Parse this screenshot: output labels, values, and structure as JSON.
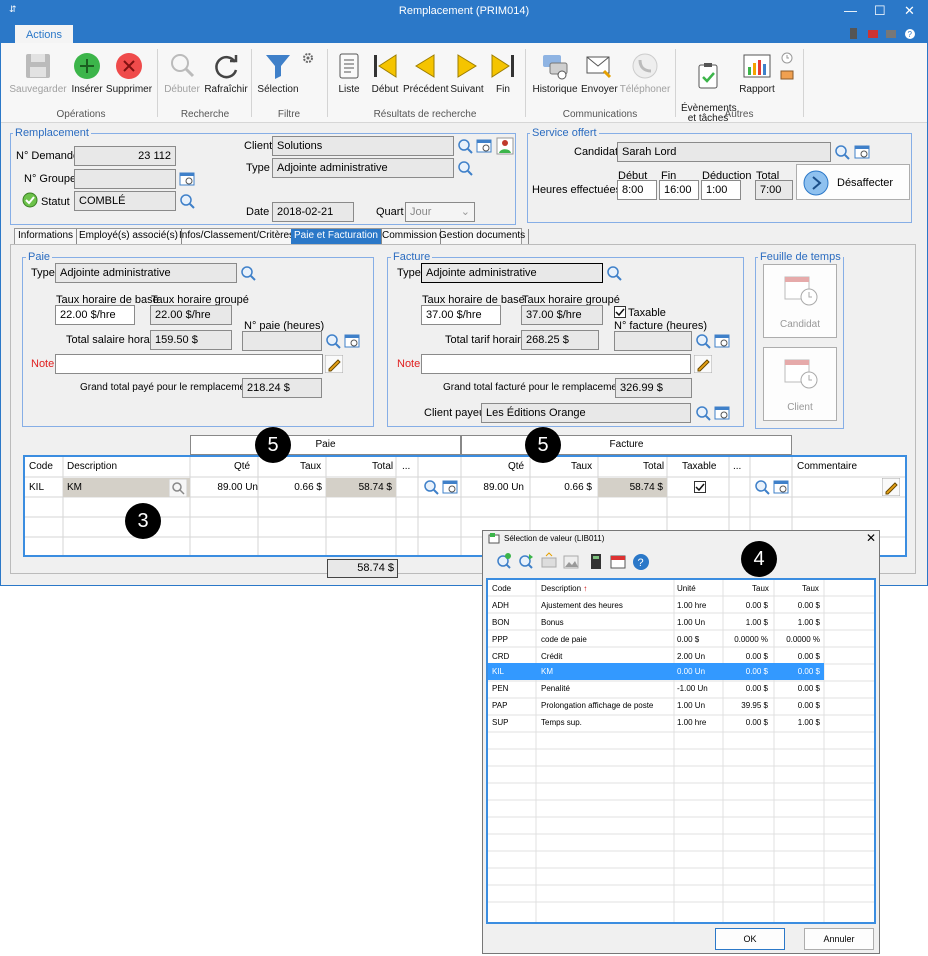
{
  "window": {
    "title": "Remplacement (PRIM014)"
  },
  "ribbon": {
    "tab": "Actions",
    "buttons": {
      "save": "Sauvegarder",
      "insert": "Insérer",
      "delete": "Supprimer",
      "start": "Débuter",
      "refresh": "Rafraîchir",
      "selection": "Sélection",
      "list": "Liste",
      "first": "Début",
      "prev": "Précédent",
      "next": "Suivant",
      "last": "Fin",
      "history": "Historique",
      "send": "Envoyer",
      "phone": "Téléphoner",
      "events": "Évènements\net tâches",
      "report": "Rapport"
    },
    "groups": {
      "operations": "Opérations",
      "search": "Recherche",
      "filter": "Filtre",
      "results": "Résultats de recherche",
      "communications": "Communications",
      "others": "Autres"
    }
  },
  "replacement": {
    "legend": "Remplacement",
    "demande_label": "N° Demande",
    "demande": "23 112",
    "groupe_label": "N° Groupe",
    "groupe": "",
    "statut_label": "Statut",
    "statut": "COMBLÉ",
    "client_label": "Client",
    "client": "Solutions",
    "type_label": "Type",
    "type": "Adjointe administrative",
    "date_label": "Date",
    "date": "2018-02-21",
    "quart_label": "Quart",
    "quart": "Jour"
  },
  "service": {
    "legend": "Service offert",
    "candidat_label": "Candidat",
    "candidat": "Sarah Lord",
    "hours_label": "Heures effectuées",
    "debut_label": "Début",
    "debut": "8:00",
    "fin_label": "Fin",
    "fin": "16:00",
    "deduction_label": "Déduction",
    "deduction": "1:00",
    "total_label": "Total",
    "total": "7:00",
    "desaffecter": "Désaffecter"
  },
  "tabs": [
    "Informations",
    "Employé(s) associé(s)",
    "Infos/Classement/Critères",
    "Paie et Facturation",
    "Commission",
    "Gestion documents"
  ],
  "paie": {
    "legend": "Paie",
    "type_label": "Type",
    "type": "Adjointe administrative",
    "base_label": "Taux horaire de base",
    "base": "22.00 $/hre",
    "groupe_label": "Taux horaire groupé",
    "groupe": "22.00 $/hre",
    "npaie_label": "N° paie (heures)",
    "npaie": "",
    "total_label": "Total salaire horaire",
    "total": "159.50 $",
    "note_label": "Note",
    "note": "",
    "grand_label": "Grand total payé pour le remplacement",
    "grand": "218.24 $"
  },
  "facture": {
    "legend": "Facture",
    "type_label": "Type",
    "type": "Adjointe administrative",
    "base_label": "Taux horaire de base",
    "base": "37.00 $/hre",
    "groupe_label": "Taux horaire groupé",
    "groupe": "37.00 $/hre",
    "taxable_label": "Taxable",
    "nfact_label": "N° facture (heures)",
    "nfact": "",
    "total_label": "Total tarif horaire",
    "total": "268.25 $",
    "note_label": "Note",
    "note": "",
    "grand_label": "Grand total facturé pour le remplacement",
    "grand": "326.99 $",
    "payeur_label": "Client payeur",
    "payeur": "Les Éditions Orange"
  },
  "timesheet": {
    "legend": "Feuille de temps",
    "candidat": "Candidat",
    "client": "Client"
  },
  "grid": {
    "paie_header": "Paie",
    "facture_header": "Facture",
    "cols": {
      "code": "Code",
      "desc": "Description",
      "qte": "Qté",
      "taux": "Taux",
      "total": "Total",
      "more": "...",
      "taxable": "Taxable",
      "comment": "Commentaire"
    },
    "row": {
      "code": "KIL",
      "desc": "KM",
      "pqte": "89.00 Un",
      "ptaux": "0.66 $",
      "ptotal": "58.74 $",
      "fqte": "89.00 Un",
      "ftaux": "0.66 $",
      "ftotal": "58.74 $"
    },
    "sum": "58.74 $"
  },
  "dialog": {
    "title": "Sélection de valeur (LIB011)",
    "cols": {
      "code": "Code",
      "desc": "Description",
      "unit": "Unité",
      "taux1": "Taux",
      "taux2": "Taux"
    },
    "rows": [
      {
        "code": "ADH",
        "desc": "Ajustement des heures",
        "unit": "1.00 hre",
        "taux1": "0.00 $",
        "taux2": "0.00 $"
      },
      {
        "code": "BON",
        "desc": "Bonus",
        "unit": "1.00 Un",
        "taux1": "1.00 $",
        "taux2": "1.00 $"
      },
      {
        "code": "PPP",
        "desc": "code de paie",
        "unit": "0.00 $",
        "taux1": "0.0000 %",
        "taux2": "0.0000 %"
      },
      {
        "code": "CRD",
        "desc": "Crédit",
        "unit": "2.00 Un",
        "taux1": "0.00 $",
        "taux2": "0.00 $"
      },
      {
        "code": "KIL",
        "desc": "KM",
        "unit": "0.00 Un",
        "taux1": "0.00 $",
        "taux2": "0.00 $"
      },
      {
        "code": "PEN",
        "desc": "Penalité",
        "unit": "-1.00 Un",
        "taux1": "0.00 $",
        "taux2": "0.00 $"
      },
      {
        "code": "PAP",
        "desc": "Prolongation affichage de poste",
        "unit": "1.00 Un",
        "taux1": "39.95 $",
        "taux2": "0.00 $"
      },
      {
        "code": "SUP",
        "desc": "Temps sup.",
        "unit": "1.00 hre",
        "taux1": "0.00 $",
        "taux2": "1.00 $"
      }
    ],
    "ok": "OK",
    "cancel": "Annuler"
  },
  "callouts": {
    "c3": "3",
    "c4": "4",
    "c5a": "5",
    "c5b": "5"
  },
  "colors": {
    "accent": "#2b78c8",
    "selected_row": "#3399ff"
  }
}
